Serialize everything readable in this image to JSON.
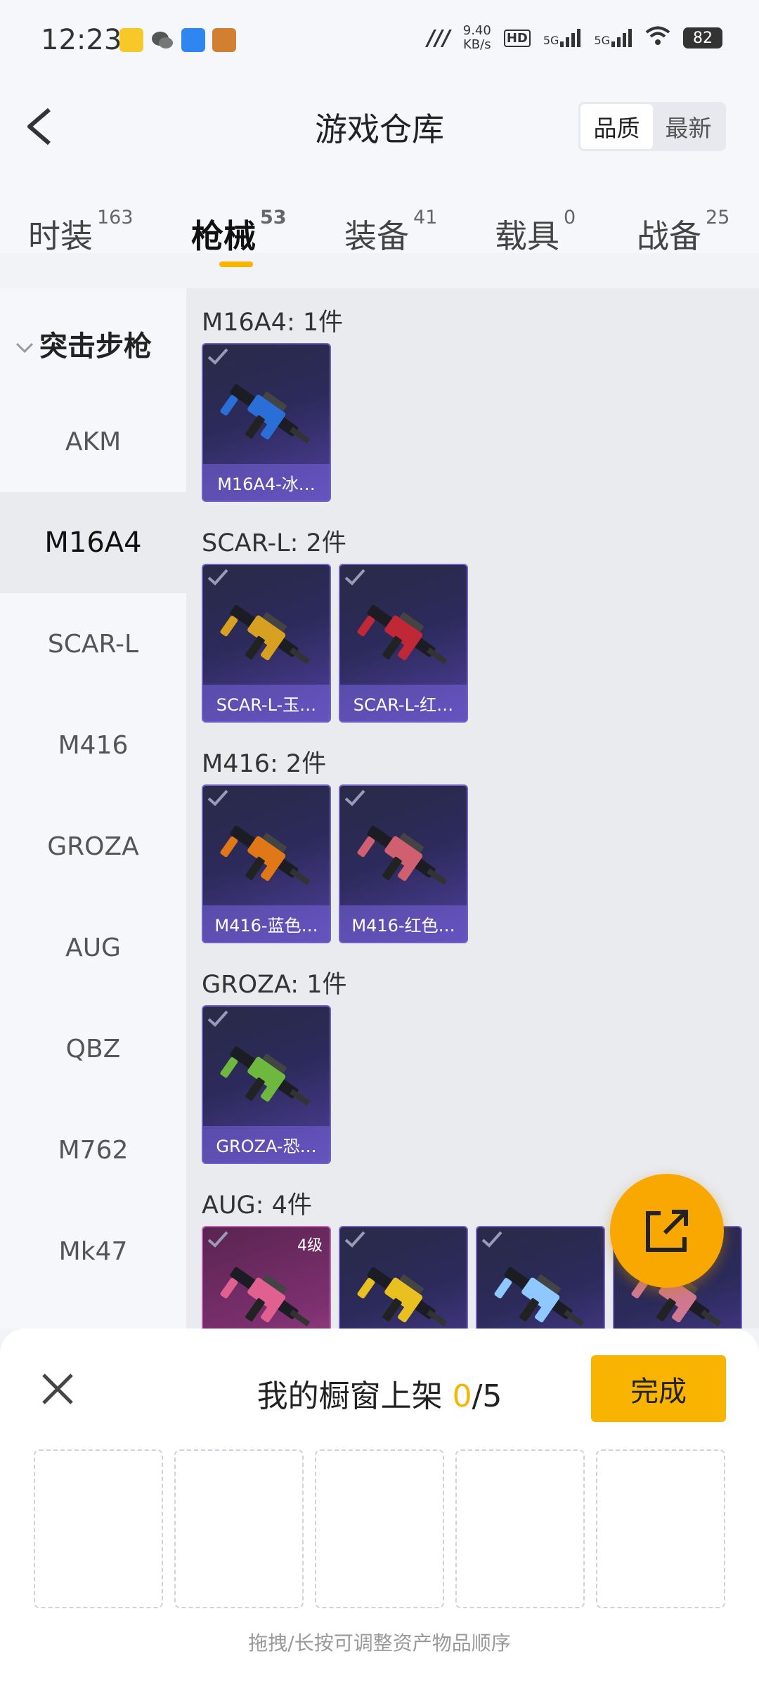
{
  "status_bar": {
    "time": "12:23",
    "network_speed": "9.40",
    "network_unit": "KB/s",
    "signal_1": "5G",
    "signal_2": "5G",
    "hd_label": "HD",
    "battery": "82"
  },
  "header": {
    "title": "游戏仓库",
    "sort_options": [
      "品质",
      "最新"
    ],
    "sort_selected": "品质"
  },
  "tabs": [
    {
      "label": "时装",
      "count": "163"
    },
    {
      "label": "枪械",
      "count": "53"
    },
    {
      "label": "装备",
      "count": "41"
    },
    {
      "label": "载具",
      "count": "0"
    },
    {
      "label": "战备",
      "count": "25"
    }
  ],
  "active_tab": "枪械",
  "sidebar": {
    "category": "突击步枪",
    "items": [
      "AKM",
      "M16A4",
      "SCAR-L",
      "M416",
      "GROZA",
      "AUG",
      "QBZ",
      "M762",
      "Mk47"
    ],
    "selected": "M16A4"
  },
  "groups": [
    {
      "title": "M16A4: 1件",
      "items": [
        {
          "name": "M16A4-冰…",
          "gun_color": "#2a6fd8"
        }
      ]
    },
    {
      "title": "SCAR-L: 2件",
      "items": [
        {
          "name": "SCAR-L-玉…",
          "gun_color": "#d8a020"
        },
        {
          "name": "SCAR-L-红…",
          "gun_color": "#c02838"
        }
      ]
    },
    {
      "title": "M416: 2件",
      "items": [
        {
          "name": "M416-蓝色…",
          "gun_color": "#e07818"
        },
        {
          "name": "M416-红色…",
          "gun_color": "#d06070"
        }
      ]
    },
    {
      "title": "GROZA: 1件",
      "items": [
        {
          "name": "GROZA-恐…",
          "gun_color": "#6fb840"
        }
      ]
    },
    {
      "title": "AUG: 4件",
      "items": [
        {
          "name": "",
          "level": "4级",
          "gun_color": "#e06090"
        },
        {
          "name": "",
          "gun_color": "#e8c020"
        },
        {
          "name": "",
          "gun_color": "#8ec8ff"
        },
        {
          "name": "",
          "gun_color": "#d07890"
        }
      ]
    }
  ],
  "showcase": {
    "title_prefix": "我的橱窗上架",
    "used": "0",
    "separator": "/",
    "total": "5",
    "done_label": "完成",
    "hint": "拖拽/长按可调整资产物品顺序"
  },
  "colors": {
    "accent": "#f8b400",
    "fab": "#f8a800"
  }
}
